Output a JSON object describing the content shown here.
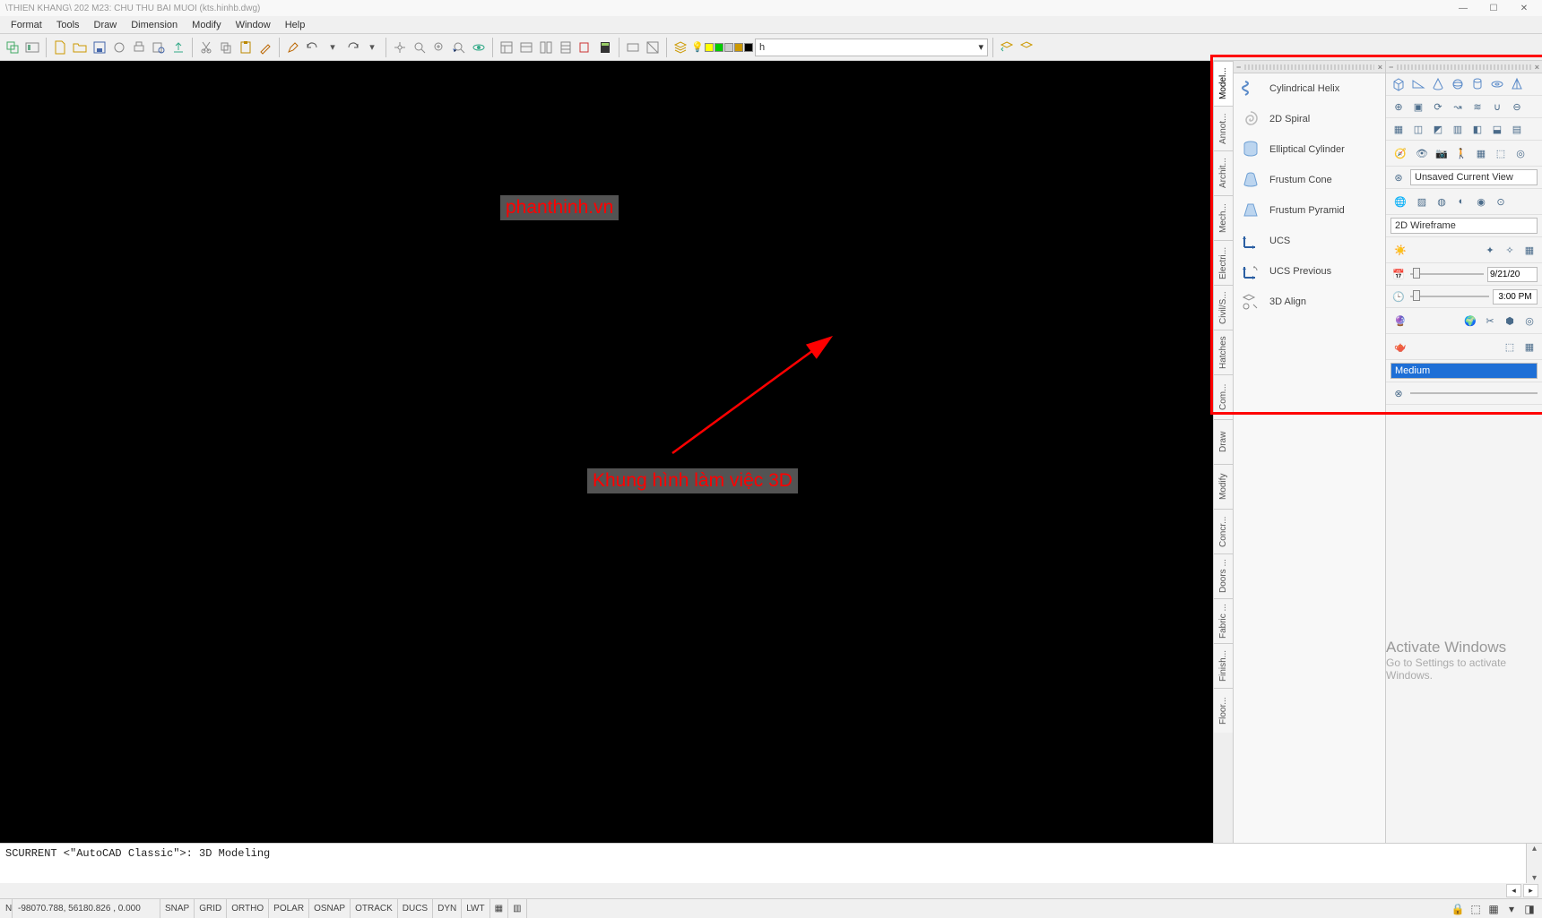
{
  "title": "\\THIEN KHANG\\ 202 M23: CHU THU BAI MUOI (kts.hinhb.dwg)",
  "menu": [
    "Format",
    "Tools",
    "Draw",
    "Dimension",
    "Modify",
    "Window",
    "Help"
  ],
  "layer_dropdown": "h",
  "annotations": {
    "watermark_text": "phanthinh.vn",
    "caption_text": "Khung hình làm việc 3D"
  },
  "vtabs": [
    "Model...",
    "Annot...",
    "Archit...",
    "Mech...",
    "Electri...",
    "Civil/S...",
    "Hatches",
    "Com...",
    "Draw",
    "Modify",
    "Concr...",
    "Doors ...",
    "Fabric ...",
    "Finish...",
    "Floor..."
  ],
  "palette_items": [
    {
      "label": "Cylindrical Helix",
      "icon": "helix"
    },
    {
      "label": "2D Spiral",
      "icon": "spiral"
    },
    {
      "label": "Elliptical Cylinder",
      "icon": "ecyl"
    },
    {
      "label": "Frustum Cone",
      "icon": "fcone"
    },
    {
      "label": "Frustum Pyramid",
      "icon": "fpyr"
    },
    {
      "label": "UCS",
      "icon": "ucs"
    },
    {
      "label": "UCS Previous",
      "icon": "ucsprev"
    },
    {
      "label": "3D Align",
      "icon": "align3d"
    }
  ],
  "prop_panel": {
    "view_dropdown": "Unsaved Current View",
    "style_dropdown": "2D Wireframe",
    "date": "9/21/20",
    "time": "3:00 PM",
    "material": "Medium"
  },
  "windows_watermark": {
    "title": "Activate Windows",
    "subtitle": "Go to Settings to activate Windows."
  },
  "command_line": "SCURRENT <\"AutoCAD Classic\">: 3D Modeling",
  "status": {
    "coords": "-98070.788, 56180.826 , 0.000",
    "toggles": [
      "SNAP",
      "GRID",
      "ORTHO",
      "POLAR",
      "OSNAP",
      "OTRACK",
      "DUCS",
      "DYN",
      "LWT"
    ]
  }
}
